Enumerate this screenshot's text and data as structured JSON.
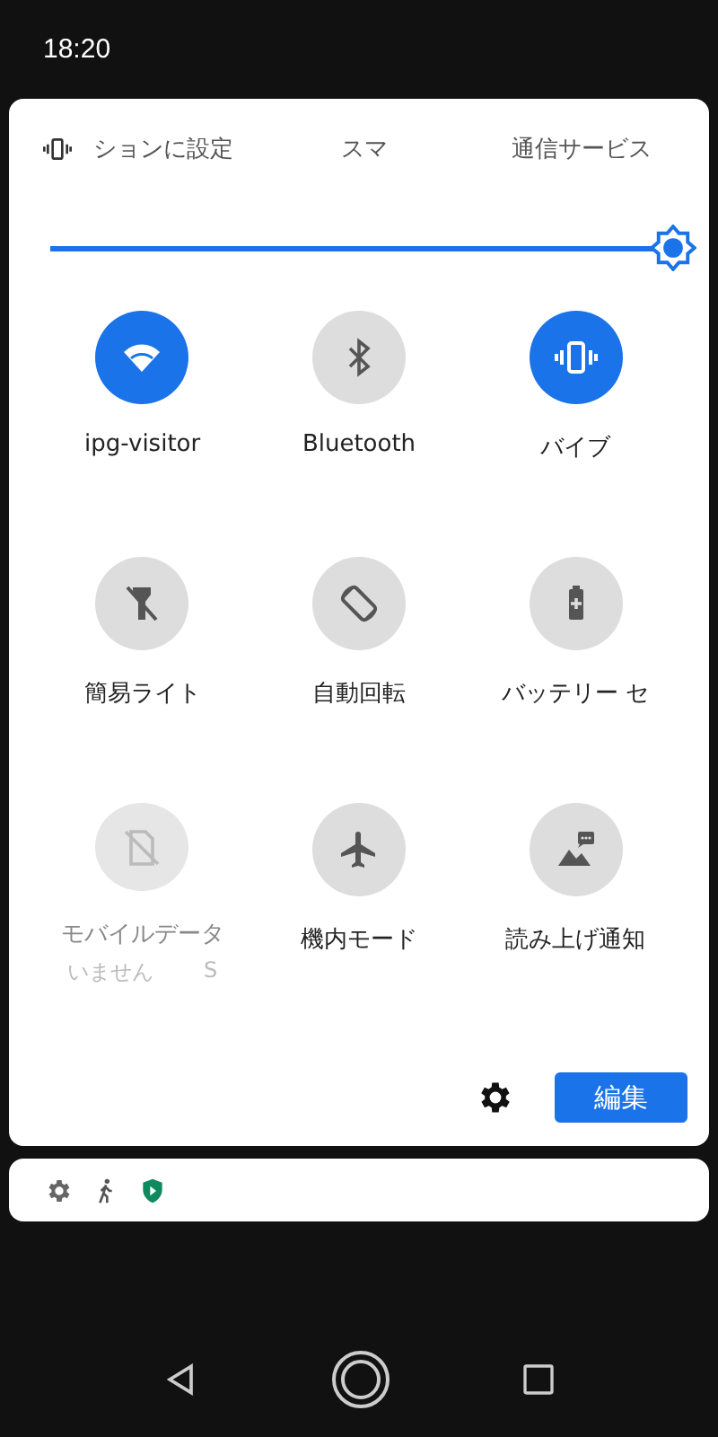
{
  "status_bar": {
    "time": "18:20"
  },
  "ticker": [
    "ションに設定",
    "スマ",
    "通信サービス"
  ],
  "brightness": {
    "level": 1.0
  },
  "tiles": [
    {
      "label": "ipg-visitor",
      "on": true,
      "disabled": false
    },
    {
      "label": "Bluetooth",
      "on": false,
      "disabled": false
    },
    {
      "label": "バイブ",
      "on": true,
      "disabled": false
    },
    {
      "label": "簡易ライト",
      "on": false,
      "disabled": false
    },
    {
      "label": "自動回転",
      "on": false,
      "disabled": false
    },
    {
      "label": "バッテリー セ",
      "on": false,
      "disabled": false
    },
    {
      "label": "モバイルデータ",
      "on": false,
      "disabled": true,
      "sublabels": [
        "いません",
        "S"
      ]
    },
    {
      "label": "機内モード",
      "on": false,
      "disabled": false
    },
    {
      "label": "読み上げ通知",
      "on": false,
      "disabled": false
    }
  ],
  "footer": {
    "edit_button": "編集"
  }
}
